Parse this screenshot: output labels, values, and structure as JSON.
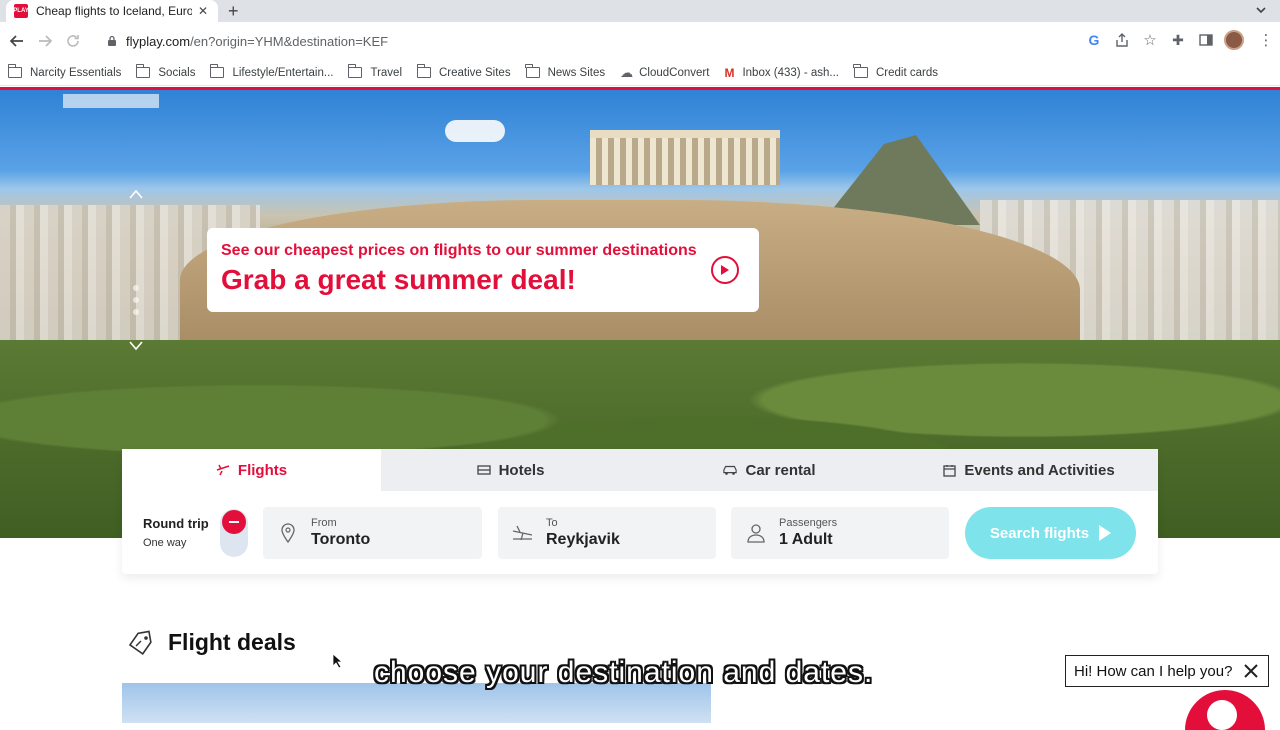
{
  "browser": {
    "tab_title": "Cheap flights to Iceland, Europe",
    "tab_favicon_text": "PLAY",
    "url_host": "flyplay.com",
    "url_path": "/en?origin=YHM&destination=KEF"
  },
  "bookmarks": [
    {
      "label": "Narcity Essentials",
      "icon": "folder-icon"
    },
    {
      "label": "Socials",
      "icon": "folder-icon"
    },
    {
      "label": "Lifestyle/Entertain...",
      "icon": "folder-icon"
    },
    {
      "label": "Travel",
      "icon": "folder-icon"
    },
    {
      "label": "Creative Sites",
      "icon": "folder-icon"
    },
    {
      "label": "News Sites",
      "icon": "folder-icon"
    },
    {
      "label": "CloudConvert",
      "icon": "cloud-icon"
    },
    {
      "label": "Inbox (433) - ash...",
      "icon": "gmail-icon"
    },
    {
      "label": "Credit cards",
      "icon": "folder-icon"
    }
  ],
  "promo": {
    "subtitle": "See our cheapest prices on flights to our summer destinations",
    "title": "Grab a great summer deal!"
  },
  "search": {
    "tabs": [
      {
        "label": "Flights",
        "icon": "plane-icon",
        "active": true
      },
      {
        "label": "Hotels",
        "icon": "bed-icon",
        "active": false
      },
      {
        "label": "Car rental",
        "icon": "car-icon",
        "active": false
      },
      {
        "label": "Events and Activities",
        "icon": "calendar-icon",
        "active": false
      }
    ],
    "trip_round": "Round trip",
    "trip_oneway": "One way",
    "from_label": "From",
    "from_value": "Toronto",
    "to_label": "To",
    "to_value": "Reykjavik",
    "passengers_label": "Passengers",
    "passengers_value": "1 Adult",
    "button": "Search flights"
  },
  "deals": {
    "title": "Flight deals"
  },
  "caption": "choose your destination and dates.",
  "chat": {
    "prompt": "Hi! How can I help you?"
  },
  "colors": {
    "brand": "#e30f3a",
    "search_button": "#7fe3ec"
  }
}
